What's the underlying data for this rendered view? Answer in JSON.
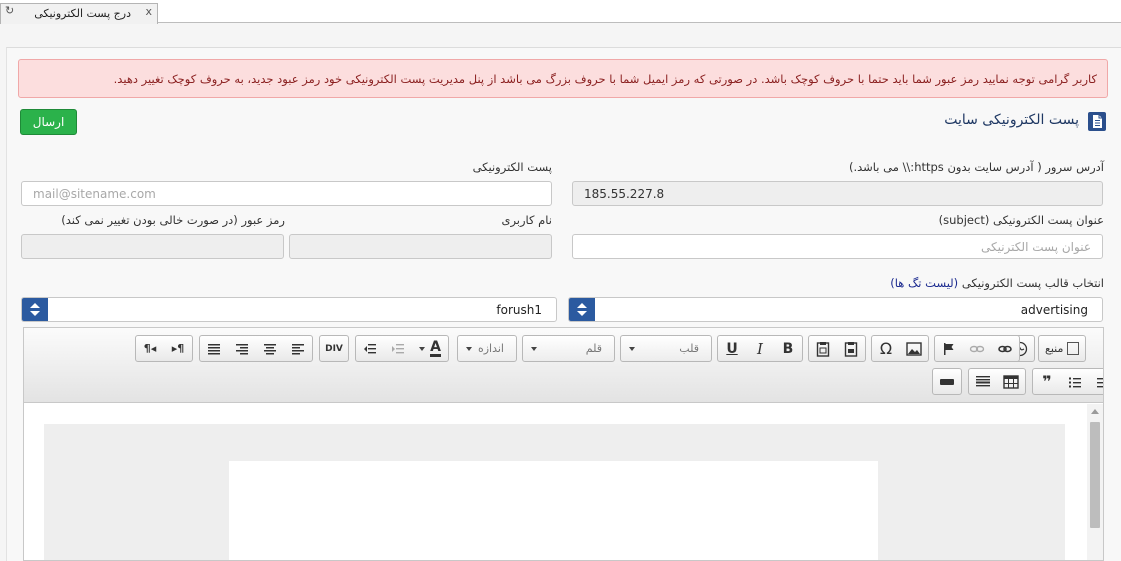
{
  "tab": {
    "label": "درج پست الکترونیکی",
    "close": "x",
    "refresh": "↻"
  },
  "alert": {
    "text": "کاربر گرامی توجه نمایید رمز عبور شما باید حتما با حروف کوچک باشد. در صورتی که رمز ایمیل شما با حروف بزرگ می باشد از پنل مدیریت پست الکترونیکی خود رمز عبود جدید، به حروف کوچک تغییر دهید."
  },
  "header": {
    "title": "پست الکترونیکی سایت",
    "send_label": "ارسال"
  },
  "form": {
    "server_label_prefix": "آدرس سرور ( آدرس سایت بدون ",
    "server_label_proto": "https:\\\\",
    "server_label_suffix": " می باشد.)",
    "server_value": "185.55.227.8",
    "email_label": "پست الکترونیکی",
    "email_placeholder": "mail@sitename.com",
    "subject_label": "عنوان پست الکترونیکی (subject)",
    "subject_placeholder": "عنوان پست الکترنیکی",
    "username_label": "نام کاربری",
    "password_label": "رمز عبور (در صورت خالی بودن تغییر نمی کند)",
    "template_label_main": "انتخاب قالب پست الکترونیکی ",
    "template_label_accent": "(لیست تگ ها)",
    "template_value": "advertising",
    "account_value": "forush1"
  },
  "editor": {
    "source_label": "منبع",
    "font_label": "قلم",
    "format_label": "قلب",
    "size_label": "اندازه",
    "bold": "B",
    "italic": "I",
    "underline": "U",
    "omega": "Ω",
    "font_color": "A",
    "div_label": "DIV",
    "quote": "❞",
    "ltr": "¶◂",
    "rtl": "▸¶"
  },
  "colors": {
    "accent": "#2b5aa0",
    "send": "#2bb24b",
    "alert_bg": "#fcdede",
    "alert_text": "#8a1f1f",
    "title": "#1f3863"
  }
}
